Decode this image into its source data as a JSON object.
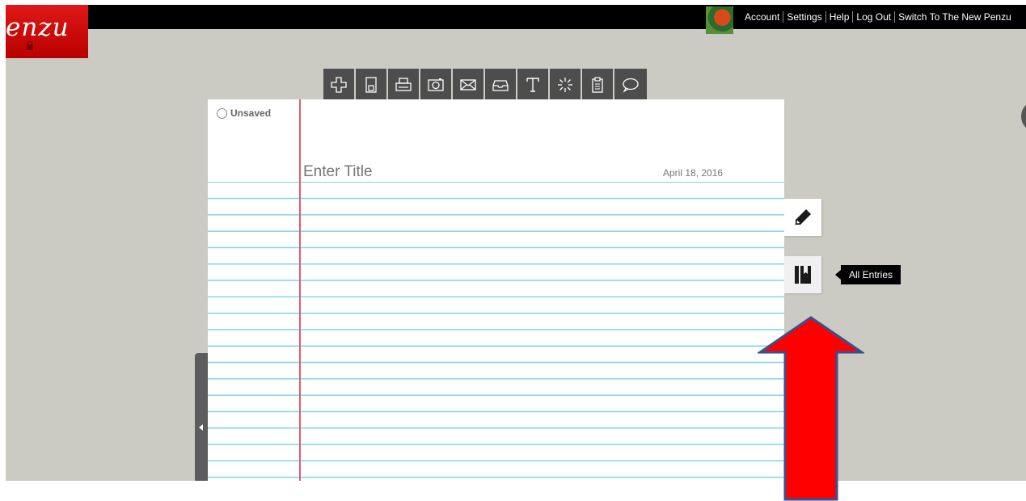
{
  "brand": {
    "logo_text": "enzu"
  },
  "topnav": {
    "account": "Account",
    "settings": "Settings",
    "help": "Help",
    "logout": "Log Out",
    "switch": "Switch To The New Penzu"
  },
  "toolbar": {
    "icons": [
      "plus-icon",
      "save-icon",
      "print-icon",
      "camera-icon",
      "mail-icon",
      "inbox-icon",
      "font-icon",
      "spinner-icon",
      "clipboard-icon",
      "comment-icon"
    ]
  },
  "entry": {
    "status": "Unsaved",
    "title_placeholder": "Enter Title",
    "date": "April 18, 2016"
  },
  "tooltip": {
    "all_entries": "All Entries"
  },
  "colors": {
    "brand_red": "#d00000",
    "background": "#cbcbc3",
    "rule_line": "#7fd3ec",
    "margin_line": "#e45c66",
    "annotation_arrow": "#ff0000"
  }
}
